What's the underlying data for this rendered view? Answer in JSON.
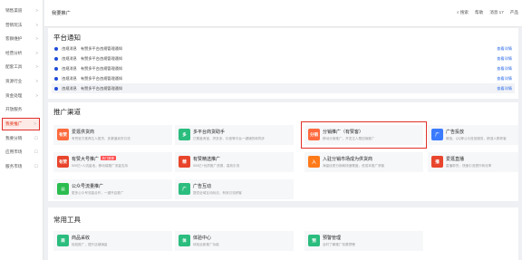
{
  "sidebar": {
    "items": [
      {
        "label": "销售渠道",
        "arrow": ">"
      },
      {
        "label": "营销玩法",
        "arrow": ">"
      },
      {
        "label": "客群维护",
        "arrow": ">"
      },
      {
        "label": "经营分析",
        "arrow": ">"
      },
      {
        "label": "配套工具",
        "arrow": ">"
      },
      {
        "label": "资源行业",
        "arrow": ">"
      },
      {
        "label": "资金处理",
        "arrow": ">"
      },
      {
        "label": "开放服务",
        "arrow": ""
      },
      {
        "label": "我要推广",
        "arrow": ">"
      },
      {
        "label": "我要分销",
        "arrow": "☐"
      },
      {
        "label": "应用市场",
        "arrow": "☐"
      },
      {
        "label": "服务市场",
        "arrow": "☐"
      }
    ]
  },
  "topbar": {
    "breadcrumb": "我要推广",
    "search": "搜索",
    "help": "帮助",
    "messages": "消息 17",
    "more": "产品"
  },
  "notices_panel": {
    "title": "平台通知",
    "items": [
      {
        "text": "违规消息　有赞多平台违规管理通知",
        "link": "查看详情"
      },
      {
        "text": "违规消息　有赞多平台违规管理通知",
        "link": "查看详情"
      },
      {
        "text": "违规消息　有赞多平台违规管理通知",
        "link": "查看详情"
      },
      {
        "text": "违规消息　有赞多平台违规管理通知",
        "link": "查看详情"
      },
      {
        "text": "违规消息　有赞多平台违规管理通知",
        "link": "查看详情"
      }
    ]
  },
  "channels_panel": {
    "title": "推广渠道",
    "cards": [
      {
        "icon": "有赞",
        "color": "#ff6a3d",
        "title": "爱逛供货商",
        "desc": "有赞官方推荐达人推货，多渠道卖货引流",
        "tag": ""
      },
      {
        "icon": "多",
        "color": "#2bbd7e",
        "title": "多平台商货助手",
        "desc": "已覆盖淘宝、拼多多、抖音等平台一键铺货和同步",
        "tag": ""
      },
      {
        "icon": "分销",
        "color": "#ff6a3d",
        "title": "分销推广（有赞客）",
        "desc": "移动分销推广，开发达人是招商推广",
        "tag": ""
      },
      {
        "icon": "广",
        "color": "#3a7bff",
        "title": "广告投放",
        "desc": "微信、QQ等公众投放服务，精准人群获客",
        "tag": ""
      },
      {
        "icon": "有赞",
        "color": "#e8452c",
        "title": "有赞大号推广",
        "desc": "500亿+人流量池，移动端推广流量支持",
        "tag": "热门推荐"
      },
      {
        "icon": "精",
        "color": "#e8452c",
        "title": "有赞精选推广",
        "desc": "500亿+优质推广资源，高效引流",
        "tag": ""
      },
      {
        "icon": "入",
        "color": "#ff7a1a",
        "title": "入驻分销市场成为供货商",
        "desc": "海量优质分销商快速覆盖，低成本推广获客",
        "tag": ""
      },
      {
        "icon": "播",
        "color": "#e8452c",
        "title": "爱逛直播",
        "desc": "直播带货，快速引流提升转化率",
        "tag": ""
      },
      {
        "icon": "公",
        "color": "#2bbd4f",
        "title": "公众号流量推广",
        "desc": "更多公众号流量合作，一键开启推广",
        "tag": ""
      },
      {
        "icon": "广",
        "color": "#2bbd7e",
        "title": "广告互动",
        "desc": "提供全域互动玩法，有效引流获客",
        "tag": ""
      }
    ]
  },
  "tools_panel": {
    "title": "常用工具",
    "cards": [
      {
        "icon": "商",
        "color": "#2bbd7e",
        "title": "商品采收",
        "desc": "轻松推广，提升店铺销量",
        "tag": ""
      },
      {
        "icon": "体",
        "color": "#2bbd7e",
        "title": "体验中心",
        "desc": "体验全新推广功能",
        "tag": ""
      },
      {
        "icon": "预",
        "color": "#2bbd7e",
        "title": "预警管理",
        "desc": "及时了解推广效果预警",
        "tag": ""
      }
    ]
  }
}
